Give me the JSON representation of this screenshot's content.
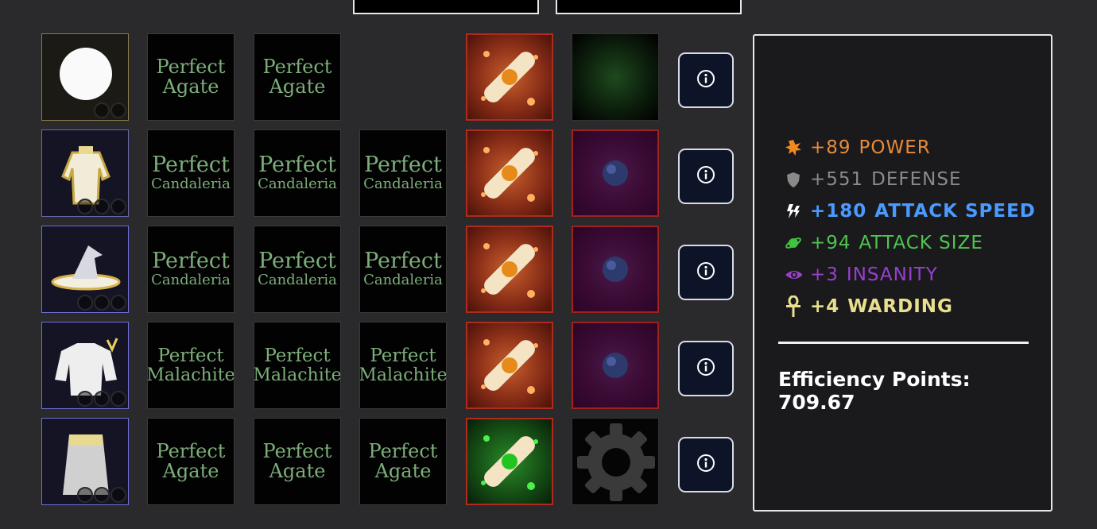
{
  "top_boxes": [
    "",
    ""
  ],
  "rows": [
    {
      "item": "ring",
      "gems": [
        {
          "line1": "Perfect",
          "line2": "Agate"
        },
        {
          "line1": "Perfect",
          "line2": "Agate"
        },
        null
      ],
      "scroll": "orange",
      "orb": "empty-green"
    },
    {
      "item": "robe",
      "gems": [
        {
          "line1": "Perfect",
          "line2": "Candaleria"
        },
        {
          "line1": "Perfect",
          "line2": "Candaleria"
        },
        {
          "line1": "Perfect",
          "line2": "Candaleria"
        }
      ],
      "scroll": "orange",
      "orb": "purple"
    },
    {
      "item": "wizard-hat",
      "gems": [
        {
          "line1": "Perfect",
          "line2": "Candaleria"
        },
        {
          "line1": "Perfect",
          "line2": "Candaleria"
        },
        {
          "line1": "Perfect",
          "line2": "Candaleria"
        }
      ],
      "scroll": "orange",
      "orb": "purple"
    },
    {
      "item": "shirt",
      "gems": [
        {
          "line1": "Perfect",
          "line2": "Malachite"
        },
        {
          "line1": "Perfect",
          "line2": "Malachite"
        },
        {
          "line1": "Perfect",
          "line2": "Malachite"
        }
      ],
      "scroll": "orange",
      "orb": "purple"
    },
    {
      "item": "skirt",
      "gems": [
        {
          "line1": "Perfect",
          "line2": "Agate"
        },
        {
          "line1": "Perfect",
          "line2": "Agate"
        },
        {
          "line1": "Perfect",
          "line2": "Agate"
        }
      ],
      "scroll": "green",
      "orb": "gear"
    }
  ],
  "info_icon": "info-icon",
  "stats": [
    {
      "icon": "power-star-icon",
      "value": "+89",
      "label": "POWER",
      "color": "#e88a3a"
    },
    {
      "icon": "shield-icon",
      "value": "+551",
      "label": "DEFENSE",
      "color": "#8a8a8a"
    },
    {
      "icon": "lightning-icon",
      "value": "+180",
      "label": "ATTACK SPEED",
      "color": "#4a9aff"
    },
    {
      "icon": "planet-icon",
      "value": "+94",
      "label": "ATTACK SIZE",
      "color": "#4fc44f"
    },
    {
      "icon": "eye-icon",
      "value": "+3",
      "label": "INSANITY",
      "color": "#9a3ed0"
    },
    {
      "icon": "ankh-icon",
      "value": "+4",
      "label": "WARDING",
      "color": "#e8e08c"
    }
  ],
  "efficiency": {
    "label": "Efficiency Points:",
    "value": "709.67"
  }
}
